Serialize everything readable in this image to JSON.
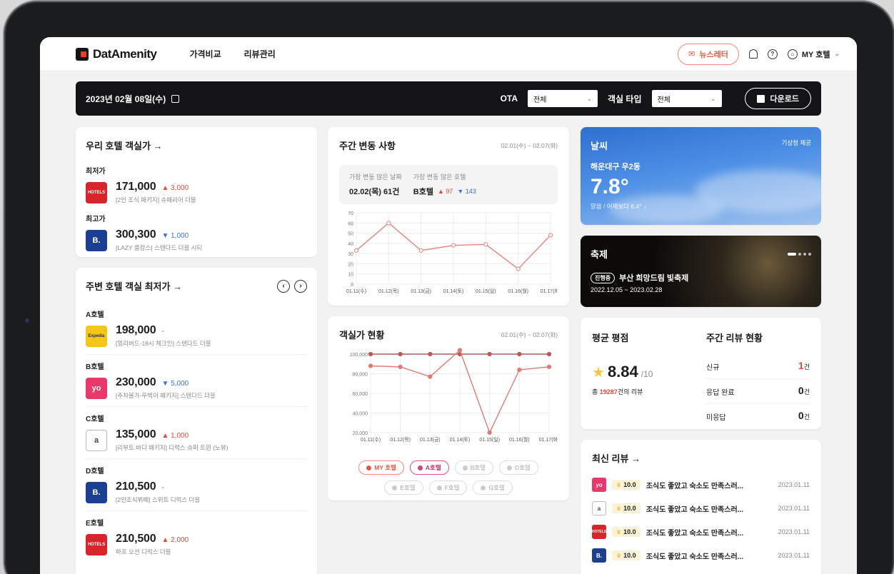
{
  "nav": {
    "logo": "DatAmenity",
    "links": [
      "가격비교",
      "리뷰관리"
    ],
    "newsletter": "뉴스레터",
    "account": "MY 호텔"
  },
  "filter": {
    "date": "2023년 02월 08일(수)",
    "ota_label": "OTA",
    "ota_value": "전체",
    "room_label": "객실 타입",
    "room_value": "전체",
    "download": "다운로드"
  },
  "our_price": {
    "title": "우리 호텔 객실가 →",
    "lowest_label": "최저가",
    "lowest_price": "171,000",
    "lowest_delta": "▲ 3,000",
    "lowest_desc": "[2인 조식 패키지] 슈페리어 더블",
    "lowest_logo": "HOTELS",
    "highest_label": "최고가",
    "highest_price": "300,300",
    "highest_delta": "▼ 1,000",
    "highest_desc": "[LAZY 룸캉스] 스탠다드 더블 시티",
    "highest_logo": "B."
  },
  "nearby": {
    "title": "주변 호텔 객실 최저가 →",
    "prev": "‹",
    "next": "›",
    "hotels": [
      {
        "name": "A호텔",
        "price": "198,000",
        "delta": "-",
        "trend": "flat",
        "desc": "[얼리버드-18시 체크인] 스탠다드 더블",
        "logo": "Expedia",
        "color": "#f5c518",
        "textColor": "#1f2b58"
      },
      {
        "name": "B호텔",
        "price": "230,000",
        "delta": "▼ 5,000",
        "trend": "down",
        "desc": "[주차불가-뚜벅이 패키지] 스탠다드 더블",
        "logo": "yo",
        "color": "#e9386a",
        "textColor": "#ffffff"
      },
      {
        "name": "C호텔",
        "price": "135,000",
        "delta": "▲ 1,000",
        "trend": "up",
        "desc": "[리부트 바디 패키지] 디럭스 슈퍼 트윈 (노뷰)",
        "logo": "a",
        "color": "#ffffff",
        "textColor": "#444444"
      },
      {
        "name": "D호텔",
        "price": "210,500",
        "delta": "-",
        "trend": "flat",
        "desc": "[2인조식뷔페] 스위트 디럭스 더블",
        "logo": "B.",
        "color": "#1d3f8f",
        "textColor": "#ffffff"
      },
      {
        "name": "E호텔",
        "price": "210,500",
        "delta": "▲ 2,000",
        "trend": "up",
        "desc": "하프 오션 디럭스 더블",
        "logo": "HOTELS",
        "color": "#d8252c",
        "textColor": "#ffffff"
      }
    ]
  },
  "weekly": {
    "title": "주간 변동 사항",
    "range": "02.01(수) ~ 02.07(화)",
    "most_day_label": "가장 변동 많은 날짜",
    "most_day_value": "02.02(목) 61건",
    "most_hotel_label": "가장 변동 많은 호텔",
    "most_hotel_value": "B호텔",
    "up_count": "▲ 97",
    "down_count": "▼ 143"
  },
  "room_price": {
    "title": "객실가 현황",
    "range": "02.01(수) ~ 02.07(화)",
    "legend": [
      "MY 호텔",
      "A호텔",
      "B호텔",
      "D호텔",
      "E호텔",
      "F호텔",
      "G호텔"
    ]
  },
  "weather": {
    "title": "날씨",
    "source": "기상청 제공",
    "location": "해운대구 우2동",
    "temp": "7.8°",
    "desc": "맑음 / 어제보다 6.4° ↓"
  },
  "festival": {
    "title": "축제",
    "tag": "진행중",
    "name": "부산 희망드림 빛축제",
    "period": "2022.12.05 ~ 2023.02.28"
  },
  "rating": {
    "title": "평균 평점",
    "score": "8.84",
    "out_of": "/10",
    "total_prefix": "총 ",
    "total_count": "19287",
    "total_suffix": "건의 리뷰"
  },
  "weekly_review": {
    "title": "주간 리뷰 현황",
    "rows": [
      {
        "label": "신규",
        "value": "1",
        "unit": "건",
        "highlight": true
      },
      {
        "label": "응답 완료",
        "value": "0",
        "unit": "건",
        "highlight": false
      },
      {
        "label": "미응답",
        "value": "0",
        "unit": "건",
        "highlight": false
      }
    ]
  },
  "latest": {
    "title": "최신 리뷰 →",
    "rows": [
      {
        "logo": "yo",
        "color": "#e9386a",
        "tc": "#ffffff",
        "score": "10.0",
        "text": "조식도 좋았고 숙소도 만족스러...",
        "date": "2023.01.11"
      },
      {
        "logo": "a",
        "color": "#ffffff",
        "tc": "#444444",
        "score": "10.0",
        "text": "조식도 좋았고 숙소도 만족스러...",
        "date": "2023.01.11"
      },
      {
        "logo": "HOTELS",
        "color": "#d8252c",
        "tc": "#ffffff",
        "score": "10.0",
        "text": "조식도 좋았고 숙소도 만족스러...",
        "date": "2023.01.11"
      },
      {
        "logo": "B.",
        "color": "#1d3f8f",
        "tc": "#ffffff",
        "score": "10.0",
        "text": "조식도 좋았고 숙소도 만족스러...",
        "date": "2023.01.11"
      }
    ]
  },
  "chart_data": [
    {
      "type": "line",
      "title": "주간 변동 사항",
      "x": [
        "01.11(수)",
        "01.12(목)",
        "01.13(금)",
        "01.14(토)",
        "01.15(일)",
        "01.16(월)",
        "01.17(화)"
      ],
      "yticks": [
        "0",
        "10",
        "20",
        "30",
        "40",
        "50",
        "60",
        "70"
      ],
      "ylim": [
        0,
        70
      ],
      "series": [
        {
          "values": [
            33,
            60,
            33,
            38,
            39,
            15,
            48
          ]
        }
      ],
      "grid": true
    },
    {
      "type": "line",
      "title": "객실가 현황",
      "x": [
        "01.11(수)",
        "01.12(목)",
        "01.13(금)",
        "01.14(토)",
        "01.15(일)",
        "01.16(월)",
        "01.17(화)"
      ],
      "yticks": [
        "20,000",
        "40,000",
        "60,000",
        "80,000",
        "100,000"
      ],
      "ylim": [
        20000,
        100000
      ],
      "series": [
        {
          "name": "MY 호텔",
          "values": [
            100000,
            100000,
            100000,
            100000,
            100000,
            100000,
            100000
          ]
        },
        {
          "name": "A호텔",
          "values": [
            88000,
            87000,
            77000,
            104000,
            20000,
            84000,
            87000
          ]
        }
      ],
      "colors": [
        "#b85a5a",
        "#e07a76"
      ],
      "grid": true
    }
  ]
}
